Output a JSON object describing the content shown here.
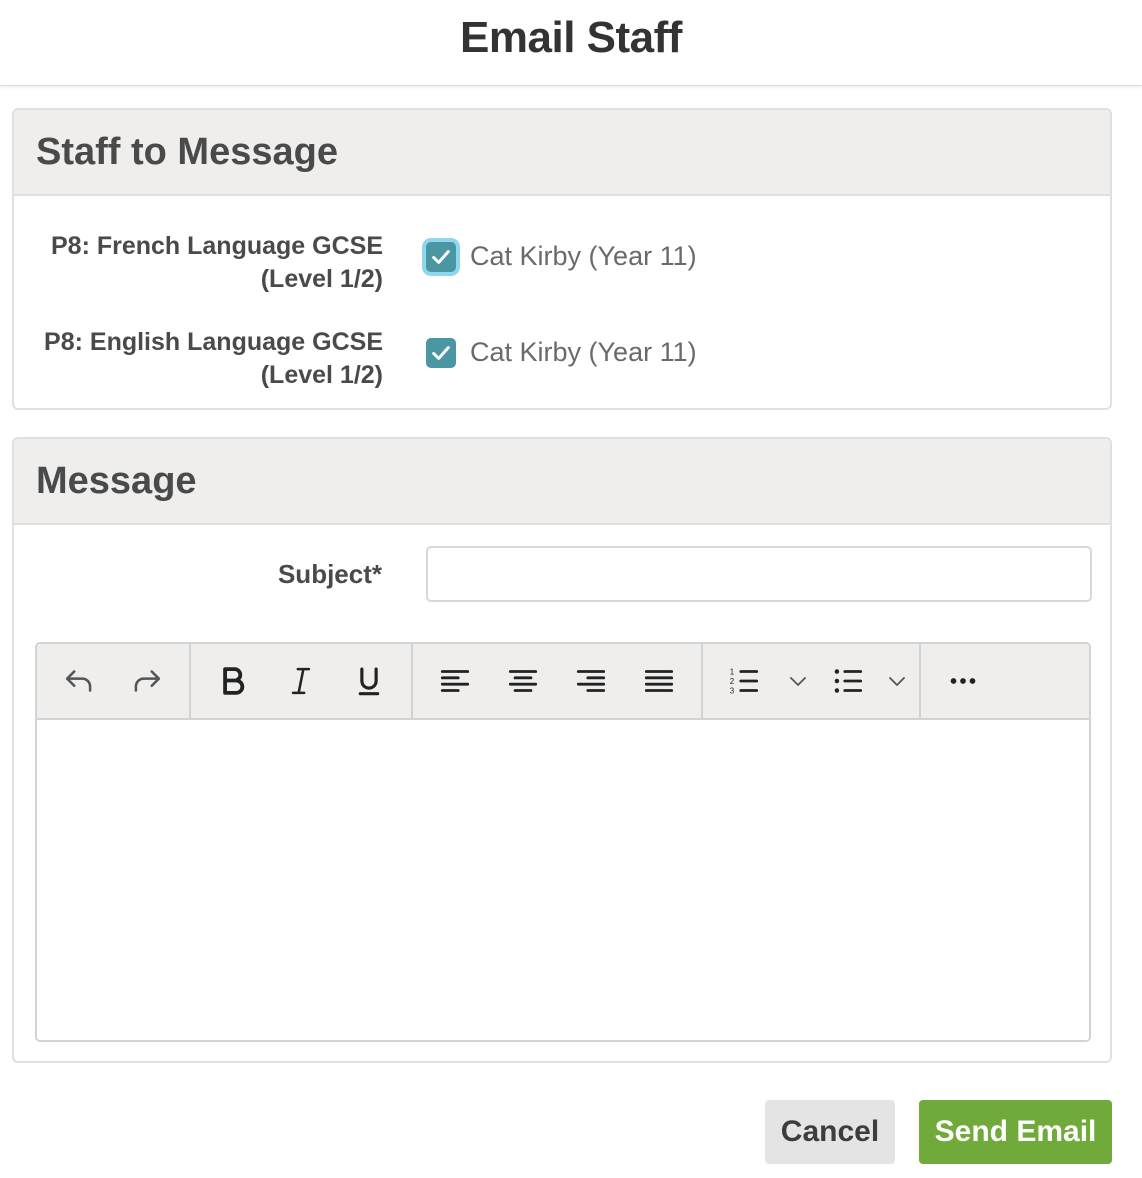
{
  "header": {
    "title": "Email Staff"
  },
  "staff_panel": {
    "title": "Staff to Message",
    "rows": [
      {
        "class_line1": "P8: French Language GCSE",
        "class_line2": "(Level 1/2)",
        "staff_name": "Cat Kirby (Year 11)",
        "checked": true
      },
      {
        "class_line1": "P8: English Language GCSE",
        "class_line2": "(Level 1/2)",
        "staff_name": "Cat Kirby (Year 11)",
        "checked": true
      }
    ]
  },
  "message_panel": {
    "title": "Message",
    "subject_label": "Subject*",
    "subject_value": "",
    "editor_content": ""
  },
  "toolbar": {
    "icons": [
      "undo-icon",
      "redo-icon",
      "bold-icon",
      "italic-icon",
      "underline-icon",
      "align-left-icon",
      "align-center-icon",
      "align-right-icon",
      "align-justify-icon",
      "numbered-list-icon",
      "chevron-down-icon",
      "bullet-list-icon",
      "chevron-down-icon",
      "more-icon"
    ]
  },
  "actions": {
    "cancel_label": "Cancel",
    "send_label": "Send Email"
  },
  "colors": {
    "checkbox": "#4a96a3",
    "send_button": "#6faa3a",
    "panel_header": "#efeeed",
    "focus_ring": "#8fd6ef"
  }
}
